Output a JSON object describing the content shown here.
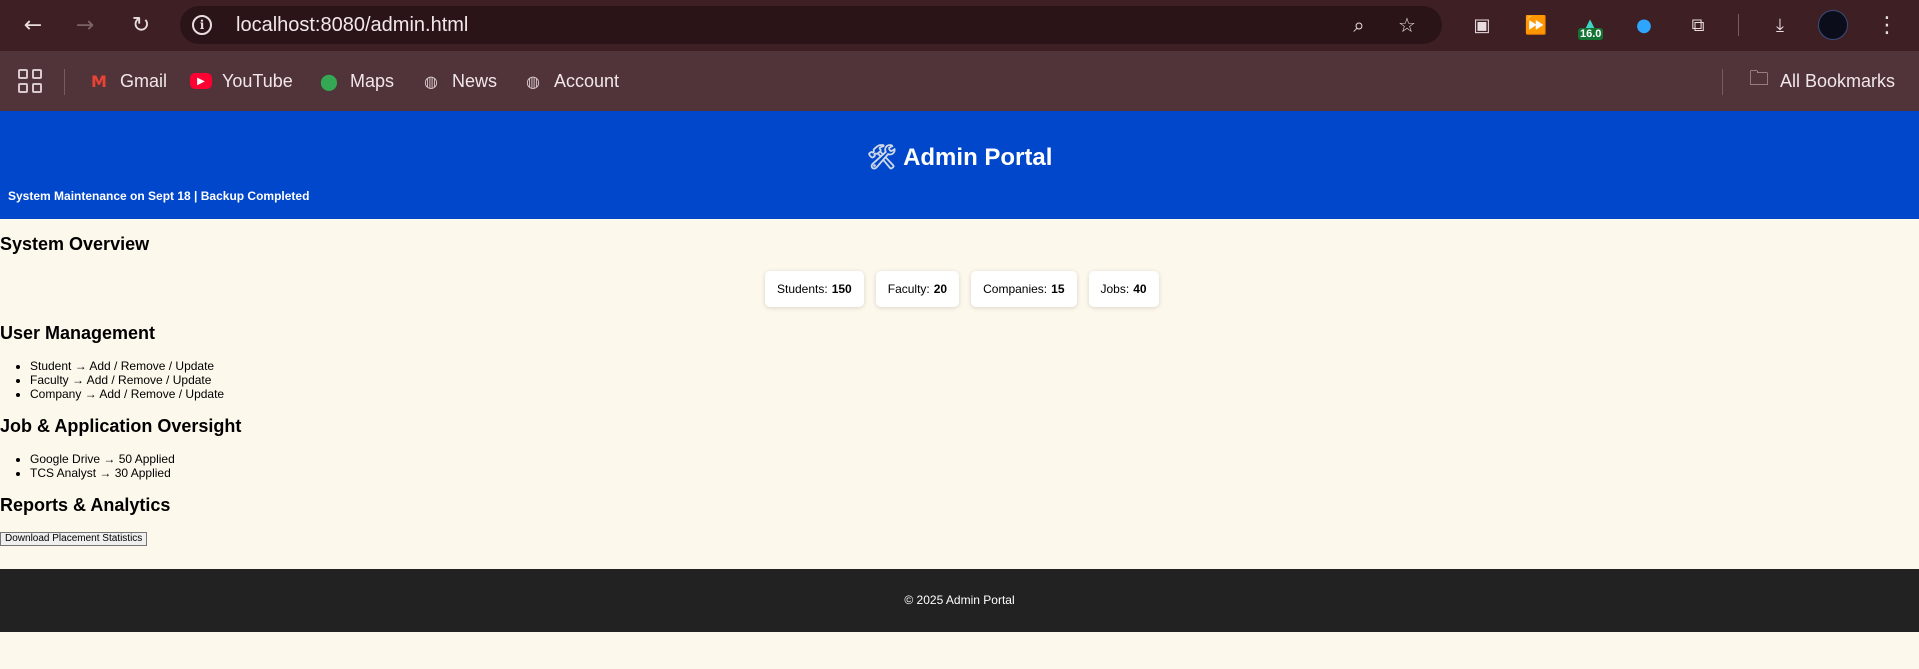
{
  "browser": {
    "url": "localhost:8080/admin.html",
    "extension_badge": "16.0",
    "bookmarks": [
      {
        "label": "Gmail",
        "icon": "gmail-icon"
      },
      {
        "label": "YouTube",
        "icon": "youtube-icon"
      },
      {
        "label": "Maps",
        "icon": "maps-icon"
      },
      {
        "label": "News",
        "icon": "globe-icon"
      },
      {
        "label": "Account",
        "icon": "globe-icon"
      }
    ],
    "all_bookmarks_label": "All Bookmarks"
  },
  "header": {
    "icon": "🛠",
    "title": "Admin Portal",
    "ticker": "System Maintenance on Sept 18 | Backup Completed"
  },
  "overview": {
    "heading": "System Overview",
    "cards": [
      {
        "label": "Students:",
        "value": "150"
      },
      {
        "label": "Faculty:",
        "value": "20"
      },
      {
        "label": "Companies:",
        "value": "15"
      },
      {
        "label": "Jobs:",
        "value": "40"
      }
    ]
  },
  "users": {
    "heading": "User Management",
    "items": [
      "Student → Add / Remove / Update",
      "Faculty → Add / Remove / Update",
      "Company → Add / Remove / Update"
    ]
  },
  "jobs": {
    "heading": "Job & Application Oversight",
    "items": [
      "Google Drive → 50 Applied",
      "TCS Analyst → 30 Applied"
    ]
  },
  "reports": {
    "heading": "Reports & Analytics",
    "button_label": "Download Placement Statistics"
  },
  "footer": {
    "text": "© 2025 Admin Portal"
  },
  "colors": {
    "header_bg": "#0047cc",
    "page_bg": "#fdf8ec",
    "footer_bg": "#222222",
    "browser_toolbar": "#3d1f24",
    "bookmarks_bar": "#51343a"
  }
}
